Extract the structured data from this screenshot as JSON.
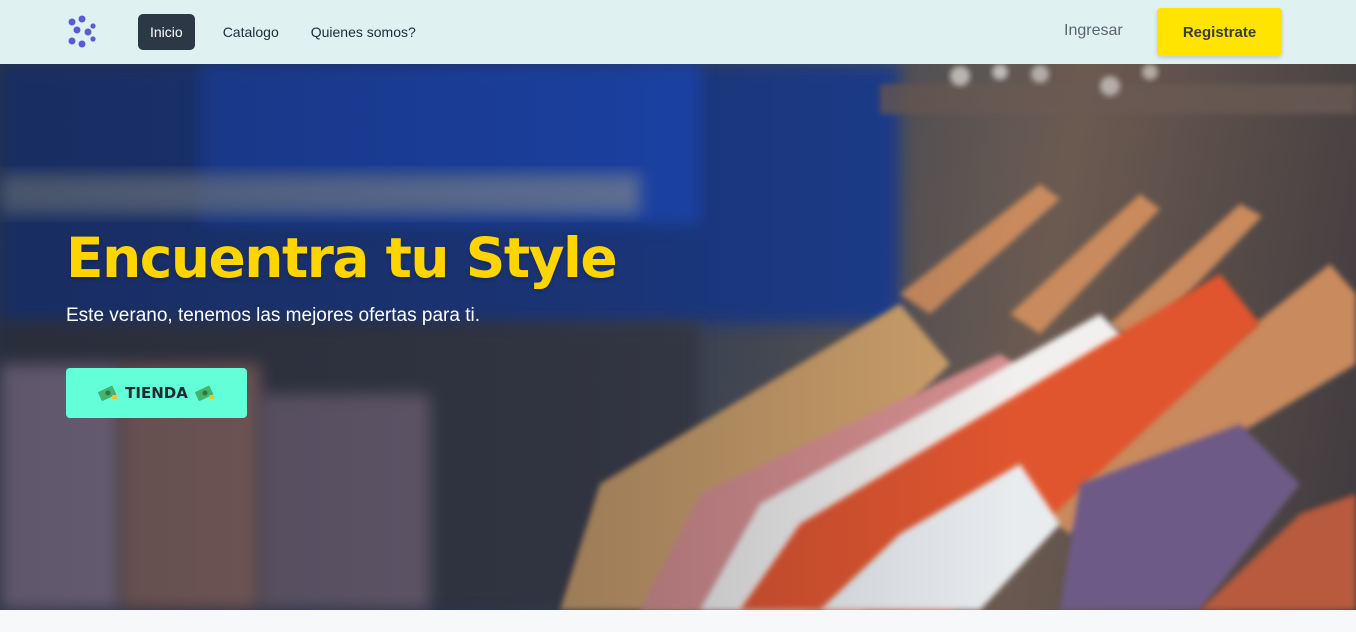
{
  "navbar": {
    "logo": {
      "icon": "brand-dots-icon",
      "color": "#5b5bd6"
    },
    "links": [
      {
        "label": "Inicio",
        "active": true
      },
      {
        "label": "Catalogo",
        "active": false
      },
      {
        "label": "Quienes somos?",
        "active": false
      }
    ],
    "login_label": "Ingresar",
    "register_label": "Registrate"
  },
  "hero": {
    "title": "Encuentra tu Style",
    "subtitle": "Este verano, tenemos las mejores ofertas para ti.",
    "shop_button": {
      "label": "TIENDA",
      "icon_left": "money-icon",
      "icon_right": "money-icon"
    },
    "background_image": "clothes-rack-photo"
  },
  "colors": {
    "navbar_bg": "#e0f1f2",
    "active_link_bg": "#2d3847",
    "register_bg": "#ffe400",
    "title_color": "#ffd500",
    "shop_button_bg": "#62ffd8"
  }
}
